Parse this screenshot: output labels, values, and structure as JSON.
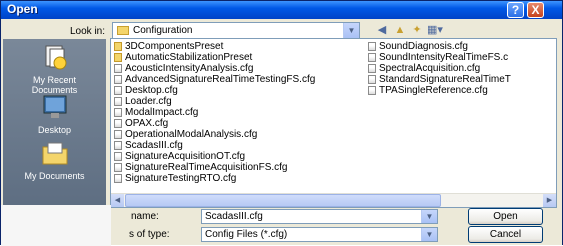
{
  "window": {
    "title": "Open",
    "help_label": "?",
    "close_label": "X"
  },
  "lookin": {
    "label": "Look in:",
    "value": "Configuration"
  },
  "toolbar": {
    "back_icon": "back-arrow-icon",
    "up_icon": "up-folder-icon",
    "new_folder_icon": "new-folder-icon",
    "views_icon": "views-menu-icon"
  },
  "places": [
    {
      "label": "My Recent Documents",
      "line1": "My Recent",
      "line2": "Documents",
      "icon": "recent-documents-icon"
    },
    {
      "label": "Desktop",
      "icon": "desktop-icon"
    },
    {
      "label": "My Documents",
      "icon": "my-documents-icon"
    }
  ],
  "files": {
    "col1": [
      {
        "name": "3DComponentsPreset",
        "type": "folder"
      },
      {
        "name": "AutomaticStabilizationPreset",
        "type": "folder"
      },
      {
        "name": "AcousticIntensityAnalysis.cfg",
        "type": "cfg"
      },
      {
        "name": "AdvancedSignatureRealTimeTestingFS.cfg",
        "type": "cfg"
      },
      {
        "name": "Desktop.cfg",
        "type": "cfg"
      },
      {
        "name": "Loader.cfg",
        "type": "cfg"
      },
      {
        "name": "ModalImpact.cfg",
        "type": "cfg"
      },
      {
        "name": "OPAX.cfg",
        "type": "cfg"
      },
      {
        "name": "OperationalModalAnalysis.cfg",
        "type": "cfg"
      },
      {
        "name": "ScadasIII.cfg",
        "type": "cfg"
      },
      {
        "name": "SignatureAcquisitionOT.cfg",
        "type": "cfg"
      },
      {
        "name": "SignatureRealTimeAcquisitionFS.cfg",
        "type": "cfg"
      },
      {
        "name": "SignatureTestingRTO.cfg",
        "type": "cfg"
      }
    ],
    "col2": [
      {
        "name": "SoundDiagnosis.cfg",
        "type": "cfg"
      },
      {
        "name": "SoundIntensityRealTimeFS.c",
        "type": "cfg"
      },
      {
        "name": "SpectralAcquisition.cfg",
        "type": "cfg"
      },
      {
        "name": "StandardSignatureRealTimeT",
        "type": "cfg"
      },
      {
        "name": "TPASingleReference.cfg",
        "type": "cfg"
      }
    ]
  },
  "filename": {
    "label": "name:",
    "value": "ScadasIII.cfg"
  },
  "filetype": {
    "label": "s of type:",
    "value": "Config Files (*.cfg)"
  },
  "buttons": {
    "open": "Open",
    "cancel": "Cancel"
  },
  "colors": {
    "titlebar": "#0058e6",
    "dialog": "#ece9d8",
    "places_bar": "#6b7b8e"
  }
}
